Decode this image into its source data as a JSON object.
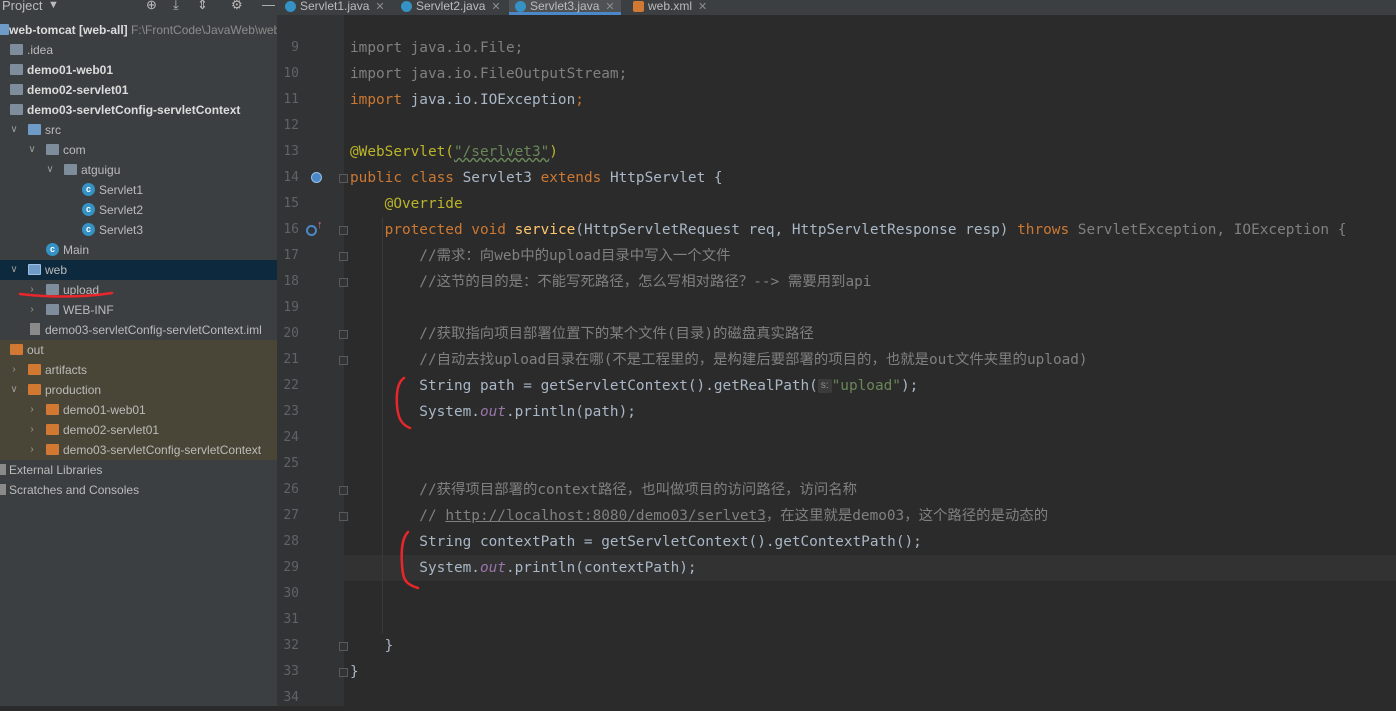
{
  "project_panel": {
    "title": "Project",
    "items": [
      {
        "label": "web-tomcat [web-all]",
        "path": "F:\\FrontCode\\JavaWeb\\web"
      },
      {
        "label": ".idea"
      },
      {
        "label": "demo01-web01"
      },
      {
        "label": "demo02-servlet01"
      },
      {
        "label": "demo03-servletConfig-servletContext"
      },
      {
        "label": "src"
      },
      {
        "label": "com"
      },
      {
        "label": "atguigu"
      },
      {
        "label": "Servlet1"
      },
      {
        "label": "Servlet2"
      },
      {
        "label": "Servlet3"
      },
      {
        "label": "Main"
      },
      {
        "label": "web"
      },
      {
        "label": "upload"
      },
      {
        "label": "WEB-INF"
      },
      {
        "label": "demo03-servletConfig-servletContext.iml"
      },
      {
        "label": "out"
      },
      {
        "label": "artifacts"
      },
      {
        "label": "production"
      },
      {
        "label": "demo01-web01"
      },
      {
        "label": "demo02-servlet01"
      },
      {
        "label": "demo03-servletConfig-servletContext"
      },
      {
        "label": "External Libraries"
      },
      {
        "label": "Scratches and Consoles"
      }
    ]
  },
  "tabs": [
    {
      "label": "Servlet1.java",
      "close": "✕"
    },
    {
      "label": "Servlet2.java",
      "close": "✕"
    },
    {
      "label": "Servlet3.java",
      "close": "✕"
    },
    {
      "label": "web.xml",
      "close": "✕"
    }
  ],
  "editor": {
    "line_numbers": [
      "9",
      "10",
      "11",
      "12",
      "13",
      "14",
      "15",
      "16",
      "17",
      "18",
      "19",
      "20",
      "21",
      "22",
      "23",
      "24",
      "25",
      "26",
      "27",
      "28",
      "29",
      "30",
      "31",
      "32",
      "33",
      "34"
    ],
    "code": {
      "l9": "import java.io.File;",
      "l10": "import java.io.FileOutputStream;",
      "l11_a": "import",
      "l11_b": " java.io.IOException",
      "l11_c": ";",
      "l13_a": "@WebServlet(",
      "l13_b": "\"/serlvet3\"",
      "l13_c": ")",
      "l14_a": "public class ",
      "l14_b": "Servlet3 ",
      "l14_c": "extends ",
      "l14_d": "HttpServlet {",
      "l15": "    @Override",
      "l16_a": "    protected void ",
      "l16_b": "service",
      "l16_c": "(HttpServletRequest req, HttpServletResponse resp) ",
      "l16_d": "throws ",
      "l16_e": "ServletException, IOException {",
      "l17": "        //需求：向web中的upload目录中写入一个文件",
      "l18": "        //这节的目的是：不能写死路径，怎么写相对路径？--> 需要用到api",
      "l20": "        //获取指向项目部署位置下的某个文件(目录)的磁盘真实路径",
      "l21": "        //自动去找upload目录在哪(不是工程里的，是构建后要部署的项目的，也就是out文件夹里的upload)",
      "l22_a": "        String path = getServletContext().getRealPath(",
      "l22_hint": "s:",
      "l22_b": "\"upload\"",
      "l22_c": ");",
      "l23_a": "        System.",
      "l23_b": "out",
      "l23_c": ".println(path);",
      "l26": "        //获得项目部署的context路径，也叫做项目的访问路径，访问名称",
      "l27_a": "        // ",
      "l27_b": "http://localhost:8080/demo03/serlvet3",
      "l27_c": "，在这里就是demo03，这个路径的是动态的",
      "l28": "        String contextPath = getServletContext().getContextPath();",
      "l29_a": "        System.",
      "l29_b": "out",
      "l29_c": ".println(contextPath);",
      "l32": "    }",
      "l33": "}"
    }
  },
  "colors": {
    "keyword": "#cc7832",
    "annotation": "#bbb529",
    "string": "#6a8759",
    "comment": "#808080",
    "accent": "#4a88c7",
    "markup": "#e8262b"
  }
}
